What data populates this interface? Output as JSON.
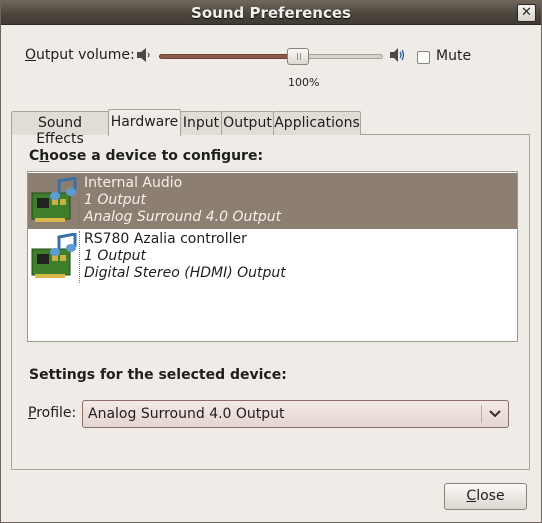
{
  "window": {
    "title": "Sound Preferences"
  },
  "volume": {
    "label_mnemonic": "O",
    "label_rest": "utput volume:",
    "value_text": "100%",
    "level_fraction": 0.62,
    "mute_label": "Mute",
    "muted": false
  },
  "tabs": [
    {
      "label": "Sound Effects",
      "active": false
    },
    {
      "label": "Hardware",
      "active": true
    },
    {
      "label": "Input",
      "active": false
    },
    {
      "label": "Output",
      "active": false
    },
    {
      "label": "Applications",
      "active": false
    }
  ],
  "hardware": {
    "choose_heading_mnemonic": "h",
    "choose_heading_prefix": "C",
    "choose_heading_rest": "oose a device to configure:",
    "devices": [
      {
        "name": "Internal Audio",
        "outputs": "1 Output",
        "profile": "Analog Surround 4.0 Output",
        "selected": true,
        "icon": "sound-card-icon"
      },
      {
        "name": "RS780 Azalia controller",
        "outputs": "1 Output",
        "profile": "Digital Stereo (HDMI) Output",
        "selected": false,
        "icon": "sound-card-icon"
      }
    ],
    "settings_heading": "Settings for the selected device:",
    "profile_label_mnemonic": "P",
    "profile_label_rest": "rofile:",
    "profile_value": "Analog Surround 4.0 Output"
  },
  "buttons": {
    "close_mnemonic": "C",
    "close_rest": "lose"
  },
  "colors": {
    "selection": "#8c7e70",
    "titlebar": "#4d463d",
    "slider_fill": "#8c5b4c"
  }
}
